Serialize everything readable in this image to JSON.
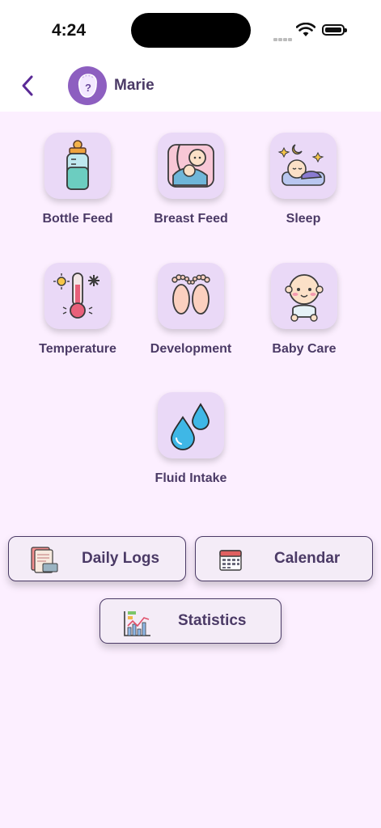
{
  "status_bar": {
    "time": "4:24"
  },
  "header": {
    "profile_name": "Marie"
  },
  "tiles": [
    {
      "label": "Bottle Feed",
      "icon": "bottle-icon"
    },
    {
      "label": "Breast Feed",
      "icon": "breastfeeding-icon"
    },
    {
      "label": "Sleep",
      "icon": "sleeping-baby-icon"
    },
    {
      "label": "Temperature",
      "icon": "thermometer-icon"
    },
    {
      "label": "Development",
      "icon": "baby-feet-icon"
    },
    {
      "label": "Baby Care",
      "icon": "baby-icon"
    },
    {
      "label": "Fluid Intake",
      "icon": "water-drops-icon"
    }
  ],
  "actions": {
    "daily_logs": "Daily Logs",
    "calendar": "Calendar",
    "statistics": "Statistics"
  },
  "colors": {
    "background": "#fcefff",
    "tile": "#ead9f7",
    "text": "#4b3a66",
    "accent": "#8d5fc0"
  }
}
